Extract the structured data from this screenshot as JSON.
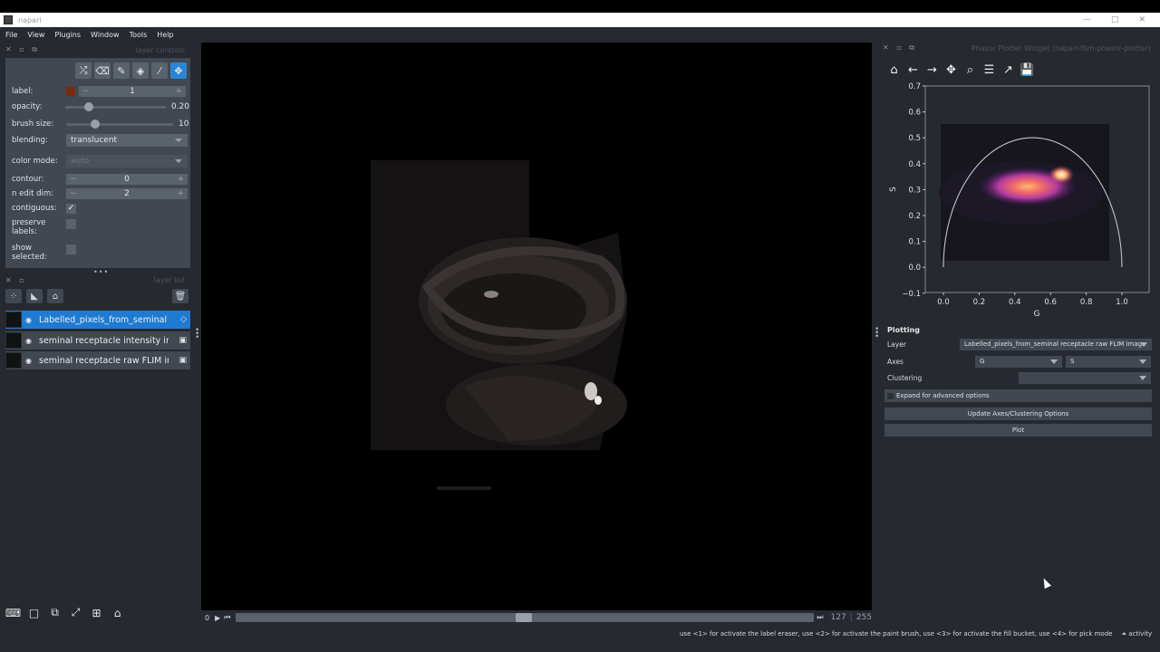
{
  "window": {
    "title": "napari"
  },
  "menu": [
    "File",
    "View",
    "Plugins",
    "Window",
    "Tools",
    "Help"
  ],
  "left_dock": {
    "controls_title": "layer controls",
    "list_title": "layer list",
    "controls": {
      "label": {
        "label": "label:",
        "value": "1"
      },
      "opacity": {
        "label": "opacity:",
        "value": "0.20",
        "fraction": 0.2
      },
      "brush_size": {
        "label": "brush size:",
        "value": "10",
        "fraction": 0.25
      },
      "blending": {
        "label": "blending:",
        "value": "translucent"
      },
      "color_mode": {
        "label": "color mode:",
        "value": "auto"
      },
      "contour": {
        "label": "contour:",
        "value": "0"
      },
      "n_edit_dim": {
        "label": "n edit dim:",
        "value": "2"
      },
      "contiguous": {
        "label": "contiguous:",
        "checked": true,
        "mark": "✓"
      },
      "preserve_labels": {
        "label": "preserve labels:"
      },
      "show_selected": {
        "label": "show selected:"
      }
    },
    "layers": [
      {
        "name": "Labelled_pixels_from_seminal receptacle raw FLIM image",
        "selected": true
      },
      {
        "name": "seminal receptacle intensity image"
      },
      {
        "name": "seminal receptacle raw FLIM image"
      }
    ]
  },
  "dims": {
    "start": "0",
    "current": "127",
    "total": "255",
    "fraction": 0.498
  },
  "right_dock": {
    "title": "Phasor Plotter Widget (napari-flim-phasor-plotter)",
    "plot": {
      "xlabel": "G",
      "ylabel": "S",
      "xticks": [
        "0.0",
        "0.2",
        "0.4",
        "0.6",
        "0.8",
        "1.0"
      ],
      "yticks": [
        "0.7",
        "0.6",
        "0.5",
        "0.4",
        "0.3",
        "0.2",
        "0.1",
        "0.0",
        "−0.1"
      ]
    },
    "plotting": {
      "title": "Plotting",
      "layer_label": "Layer",
      "layer_value": "Labelled_pixels_from_seminal receptacle raw FLIM image",
      "axes_label": "Axes",
      "axes_x": "G",
      "axes_y": "S",
      "clustering_label": "Clustering",
      "expand_label": "Expand for advanced options",
      "update_button": "Update Axes/Clustering Options",
      "plot_button": "Plot"
    }
  },
  "status": {
    "message": "use <1> for activate the label eraser, use <2> for activate the paint brush, use <3> for activate the fill bucket, use <4> for pick mode",
    "activity": "activity"
  },
  "colors": {
    "accent": "#1f7ad2",
    "panel": "#414851",
    "background": "#262930",
    "label_color": "#7a2a10"
  }
}
